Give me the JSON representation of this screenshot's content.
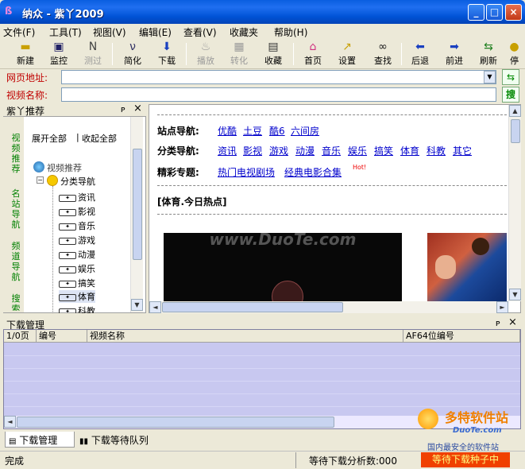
{
  "window": {
    "title": "纳众 - 紫丫2009",
    "icon": "app-logo-icon"
  },
  "menu": [
    "文件(F)",
    "工具(T)",
    "视图(V)",
    "编辑(E)",
    "查看(V)",
    "收藏夹",
    "帮助(H)"
  ],
  "toolbar": [
    {
      "label": "新建",
      "icon": "folder-new-icon",
      "enabled": true
    },
    {
      "label": "监控",
      "icon": "monitor-icon",
      "enabled": true
    },
    {
      "label": "测过",
      "icon": "n-icon",
      "enabled": false
    },
    {
      "label": "简化",
      "icon": "simplify-icon",
      "enabled": true
    },
    {
      "label": "下载",
      "icon": "download-arrow-icon",
      "enabled": true
    },
    {
      "label": "播放",
      "icon": "play-icon",
      "enabled": false
    },
    {
      "label": "转化",
      "icon": "convert-icon",
      "enabled": false
    },
    {
      "label": "收藏",
      "icon": "favorite-icon",
      "enabled": true
    },
    {
      "label": "首页",
      "icon": "home-icon",
      "enabled": true
    },
    {
      "label": "设置",
      "icon": "settings-icon",
      "enabled": true
    },
    {
      "label": "查找",
      "icon": "binoculars-icon",
      "enabled": true
    },
    {
      "label": "后退",
      "icon": "back-arrow-icon",
      "enabled": true
    },
    {
      "label": "前进",
      "icon": "forward-arrow-icon",
      "enabled": true
    },
    {
      "label": "刷新",
      "icon": "refresh-icon",
      "enabled": true
    },
    {
      "label": "停",
      "icon": "stop-icon",
      "enabled": true
    }
  ],
  "address": {
    "label": "网页地址:",
    "value": ""
  },
  "videoname": {
    "label": "视频名称:",
    "value": "",
    "search_btn": "搜"
  },
  "sidebar": {
    "title": "紫丫推荐",
    "pin": "ᴘ",
    "close": "×",
    "vtabs": [
      "视频推荐",
      "名站导航",
      "频道导航",
      "搜索"
    ],
    "expand_all": "展开全部",
    "collapse_all": "收起全部",
    "root": "视频推荐",
    "group": "分类导航",
    "items": [
      "资讯",
      "影视",
      "音乐",
      "游戏",
      "动漫",
      "娱乐",
      "搞笑",
      "体育",
      "科教"
    ]
  },
  "content": {
    "site_label": "站点导航:",
    "sites": [
      "优酷",
      "土豆",
      "酷6",
      "六间房"
    ],
    "cat_label": "分类导航:",
    "cats": [
      "资讯",
      "影视",
      "游戏",
      "动漫",
      "音乐",
      "娱乐",
      "搞笑",
      "体育",
      "科教",
      "其它"
    ],
    "topic_label": "精彩专题:",
    "topics": [
      "热门电视剧场",
      "经典电影合集"
    ],
    "hot": "Hot!",
    "section": "[体育.今日热点]",
    "watermark": "www.DuoTe.com"
  },
  "download": {
    "title": "下载管理",
    "columns": [
      "1/0页",
      "编号",
      "视频名称",
      "AF64位编号"
    ]
  },
  "bottom_tabs": [
    "下载管理",
    "下载等待队列"
  ],
  "status": {
    "left": "完成",
    "mid": "等待下载分析数:000",
    "right": "等待下载种子中"
  },
  "watermark_brand": {
    "name": "多特软件站",
    "site": "DuoTe.com",
    "slogan": "国内最安全的软件站"
  }
}
